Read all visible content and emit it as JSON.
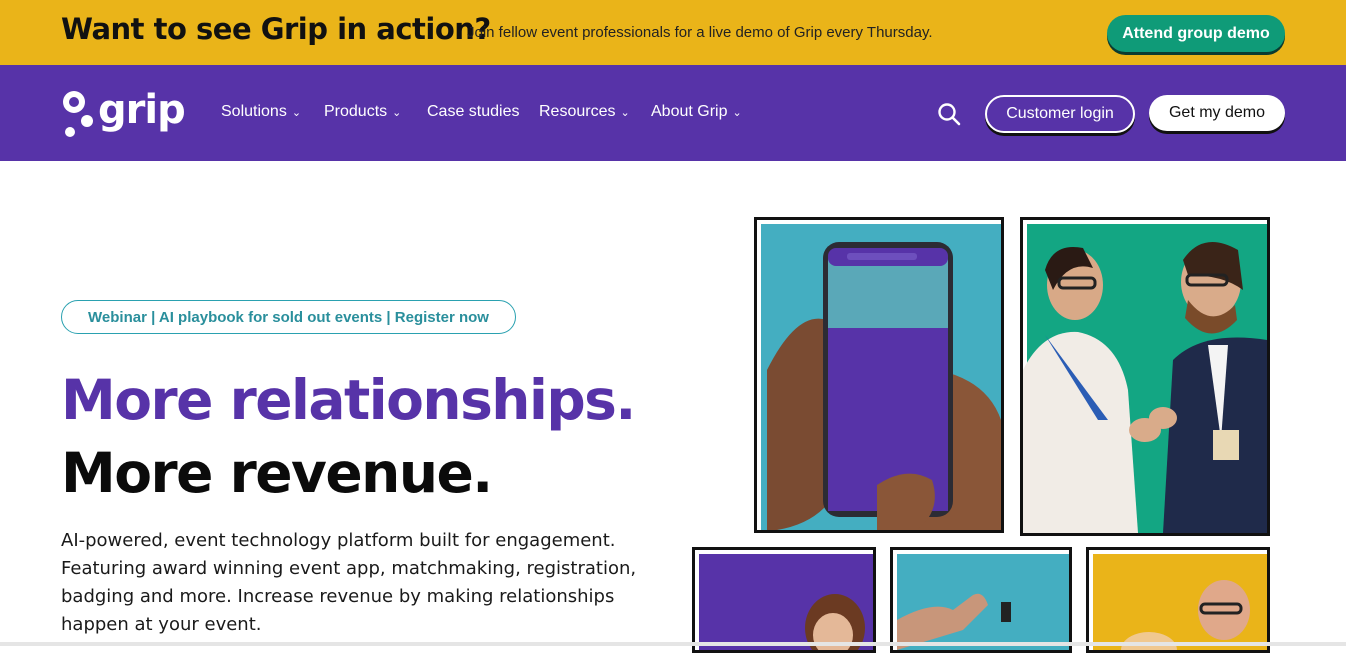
{
  "promo": {
    "title": "Want to see Grip in action?",
    "subtitle": "Join fellow event professionals for a live demo of Grip every Thursday.",
    "button": "Attend group demo"
  },
  "nav": {
    "logo": "grip",
    "items": [
      {
        "label": "Solutions",
        "has_dropdown": true
      },
      {
        "label": "Products",
        "has_dropdown": true
      },
      {
        "label": "Case studies",
        "has_dropdown": false
      },
      {
        "label": "Resources",
        "has_dropdown": true
      },
      {
        "label": "About Grip",
        "has_dropdown": true
      }
    ],
    "search_icon": "search-icon",
    "login": "Customer login",
    "demo": "Get my demo"
  },
  "hero": {
    "webinar": "Webinar | AI playbook for sold out events | Register now",
    "headline_1": "More relationships.",
    "headline_2": "More revenue.",
    "body": "AI-powered, event technology platform built for engagement. Featuring award winning event app, matchmaking, registration, badging and more. Increase revenue by making relationships happen at your event."
  },
  "colors": {
    "promo_bg": "#eab419",
    "nav_bg": "#5733a8",
    "accent_green": "#0f9b78",
    "teal": "#44aec1",
    "purple": "#5733a8"
  }
}
